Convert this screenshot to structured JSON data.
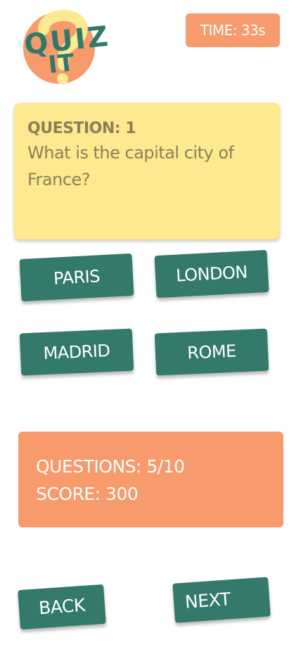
{
  "logo": {
    "line1": "QUIZ",
    "line2": "IT",
    "circle_color": "#f79a6c",
    "mark_color": "#fde98f",
    "text_color": "#2f7a6b"
  },
  "timer": {
    "label": "TIME: 33s"
  },
  "question": {
    "number_label": "QUESTION: 1",
    "text": "What is the capital city of France?"
  },
  "answers": [
    {
      "label": "PARIS"
    },
    {
      "label": "LONDON"
    },
    {
      "label": "MADRID"
    },
    {
      "label": "ROME"
    }
  ],
  "stats": {
    "questions": "QUESTIONS: 5/10",
    "score": "SCORE: 300"
  },
  "nav": {
    "back_label": "BACK",
    "next_label": "NEXT"
  },
  "colors": {
    "accent_orange": "#f79a6c",
    "card_yellow": "#fde98f",
    "button_green": "#33796c",
    "question_text": "#8a8257"
  }
}
